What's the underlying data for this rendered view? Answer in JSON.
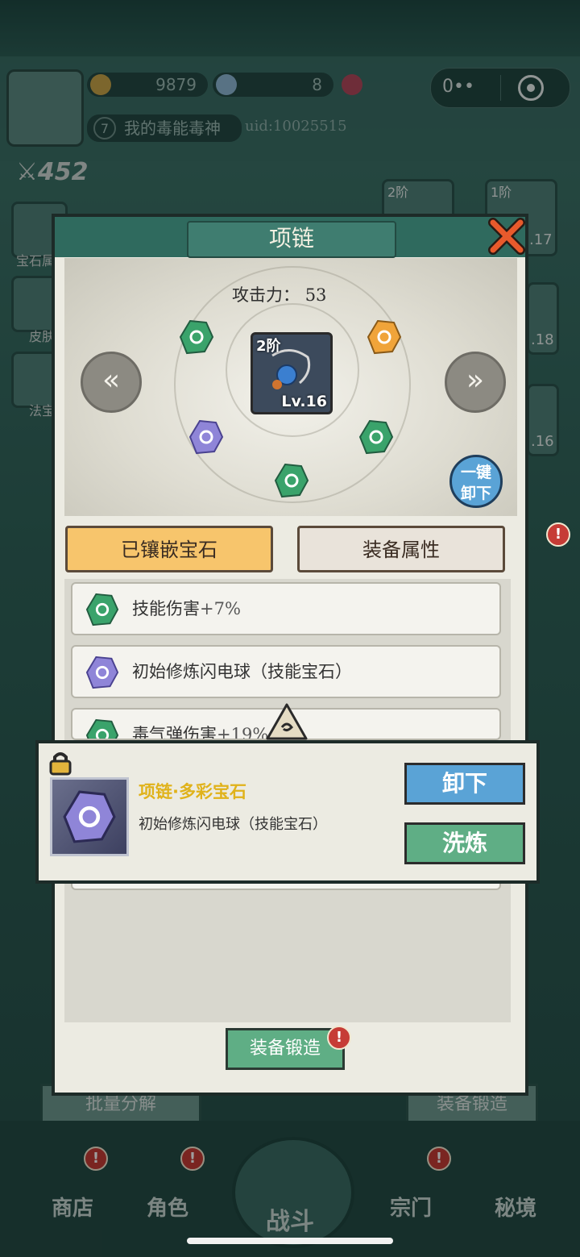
{
  "hud": {
    "coins": "9879",
    "gems": "8",
    "player_level": "7",
    "player_name": "我的毒能毒神",
    "uid": "uid:10025515",
    "power": "452",
    "menu_dots": "0••",
    "side_labels": [
      "宝石属",
      "皮肤",
      "法宝"
    ],
    "right_slots": [
      "2阶",
      "1阶"
    ],
    "right_levels": [
      ".17",
      ".18",
      ".16"
    ]
  },
  "modal": {
    "title": "项链",
    "attack_label": "攻击力：",
    "attack_value": "53",
    "item_tier": "2阶",
    "item_level": "Lv.16",
    "unequip_all": "一键卸下",
    "tabs": [
      "已镶嵌宝石",
      "装备属性"
    ],
    "gem_rows": [
      {
        "text": "技能伤害",
        "bonus": "+7%",
        "color": "green"
      },
      {
        "text": "初始修炼闪电球（技能宝石）",
        "bonus": "",
        "color": "purple"
      },
      {
        "text": "毒气弹伤害",
        "bonus": "+19%",
        "color": "green"
      }
    ],
    "forge_button": "装备锻造",
    "badge_mark": "!"
  },
  "popup": {
    "title": "项链·多彩宝石",
    "description": "初始修炼闪电球（技能宝石）",
    "unequip_button": "卸下",
    "refine_button": "洗炼"
  },
  "background_buttons": {
    "batch_decompose": "批量分解",
    "equip_forge": "装备锻造"
  },
  "nav": {
    "items": [
      "商店",
      "角色",
      "战斗",
      "宗门",
      "秘境"
    ]
  },
  "colors": {
    "title_text": "#f3f0e2",
    "popup_title": "#e0b21a",
    "tab_active": "#f7c56c",
    "tab_inactive": "#e9e3da",
    "btn_blue": "#5aa3d6",
    "btn_green": "#5fae85",
    "gem_green": "#3aa36b",
    "gem_orange": "#f0a43a",
    "gem_purple": "#8f85d8"
  }
}
